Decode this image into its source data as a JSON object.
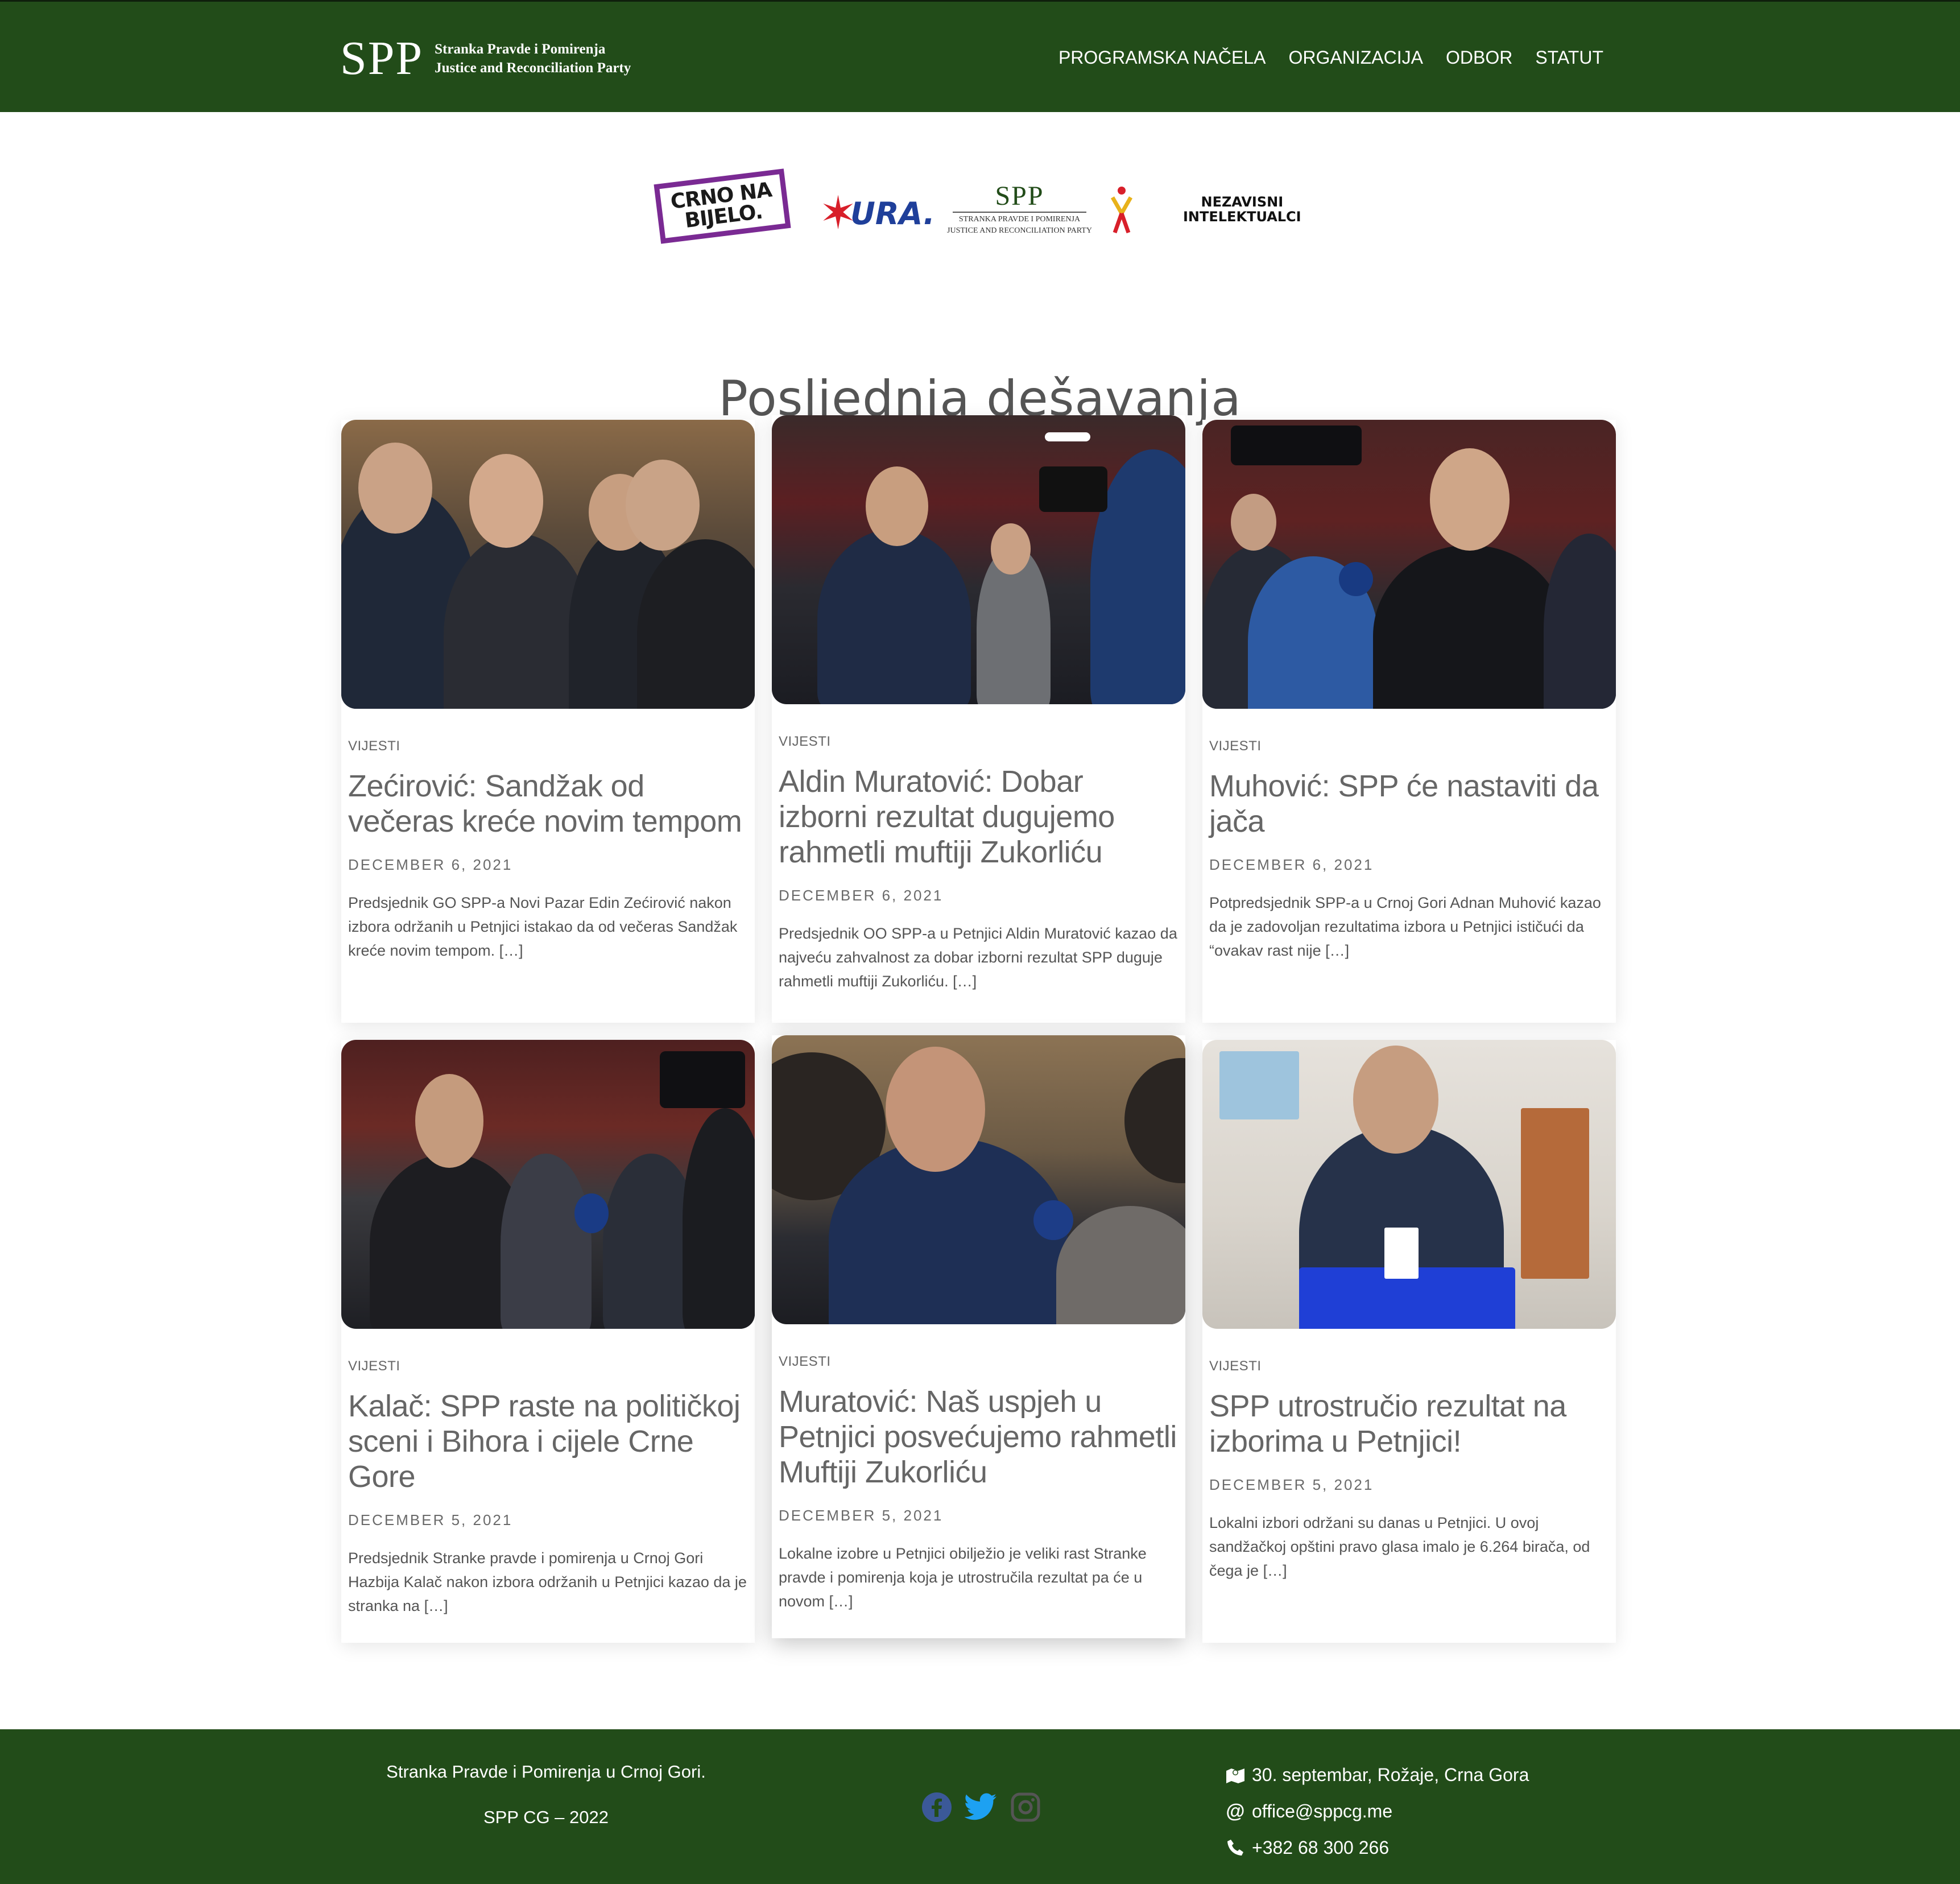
{
  "header": {
    "logo_mark": "SPP",
    "logo_line1": "Stranka Pravde i Pomirenja",
    "logo_line2": "Justice and Reconciliation Party",
    "nav": [
      "PROGRAMSKA NAČELA",
      "ORGANIZACIJA",
      "ODBOR",
      "STATUT"
    ]
  },
  "partners": {
    "cnb": "CRNO NA BIJELO.",
    "ura": "URA.",
    "spp_mark": "SPP",
    "spp_line1": "STRANKA PRAVDE I POMIRENJA",
    "spp_line2": "JUSTICE AND RECONCILIATION PARTY",
    "ni_line1": "NEZAVISNI",
    "ni_line2": "INTELEKTUALCI"
  },
  "section_title": "Posljednja dešavanja",
  "posts": [
    {
      "category": "VIJESTI",
      "title": "Zećirović: Sandžak od večeras kreće novim tempom",
      "date": "DECEMBER 6, 2021",
      "excerpt": "Predsjednik GO SPP-a Novi Pazar Edin Zećirović nakon izbora održanih u Petnjici istakao da od večeras Sandžak kreće novim tempom. […]"
    },
    {
      "category": "VIJESTI",
      "title": "Aldin Muratović: Dobar izborni rezultat dugujemo rahmetli muftiji Zukorliću",
      "date": "DECEMBER 6, 2021",
      "excerpt": "Predsjednik OO SPP-a u Petnjici Aldin Muratović kazao da najveću zahvalnost za dobar izborni rezultat SPP duguje rahmetli muftiji Zukorliću.  […]"
    },
    {
      "category": "VIJESTI",
      "title": "Muhović: SPP će nastaviti da jača",
      "date": "DECEMBER 6, 2021",
      "excerpt": "Potpredsjednik SPP-a u Crnoj Gori Adnan Muhović kazao da je zadovoljan rezultatima izbora u Petnjici ističući da “ovakav rast nije […]"
    },
    {
      "category": "VIJESTI",
      "title": "Kalač: SPP raste na političkoj sceni i Bihora i cijele Crne Gore",
      "date": "DECEMBER 5, 2021",
      "excerpt": "Predsjednik Stranke pravde i pomirenja u Crnoj Gori Hazbija Kalač nakon izbora održanih u Petnjici kazao da je stranka na […]"
    },
    {
      "category": "VIJESTI",
      "title": "Muratović: Naš uspjeh u Petnjici posvećujemo rahmetli Muftiji Zukorliću",
      "date": "DECEMBER 5, 2021",
      "excerpt": "Lokalne izobre u Petnjici obilježio je veliki rast Stranke pravde i pomirenja koja je utrostručila rezultat pa će u novom […]"
    },
    {
      "category": "VIJESTI",
      "title": "SPP utrostručio rezultat na izborima u Petnjici!",
      "date": "DECEMBER 5, 2021",
      "excerpt": "Lokalni izbori održani su danas u Petnjici. U ovoj sandžačkoj opštini pravo glasa imalo je 6.264 birača, od čega je […]"
    }
  ],
  "footer": {
    "line1": "Stranka Pravde i Pomirenja u Crnoj Gori.",
    "line2": "SPP CG – 2022",
    "address": "30. septembar, Rožaje, Crna Gora",
    "email": "office@sppcg.me",
    "phone": "+382 68 300 266"
  },
  "colors": {
    "brand_green": "#224c19",
    "facebook": "#3b5998",
    "twitter": "#1da1f2",
    "instagram": "#555555"
  }
}
